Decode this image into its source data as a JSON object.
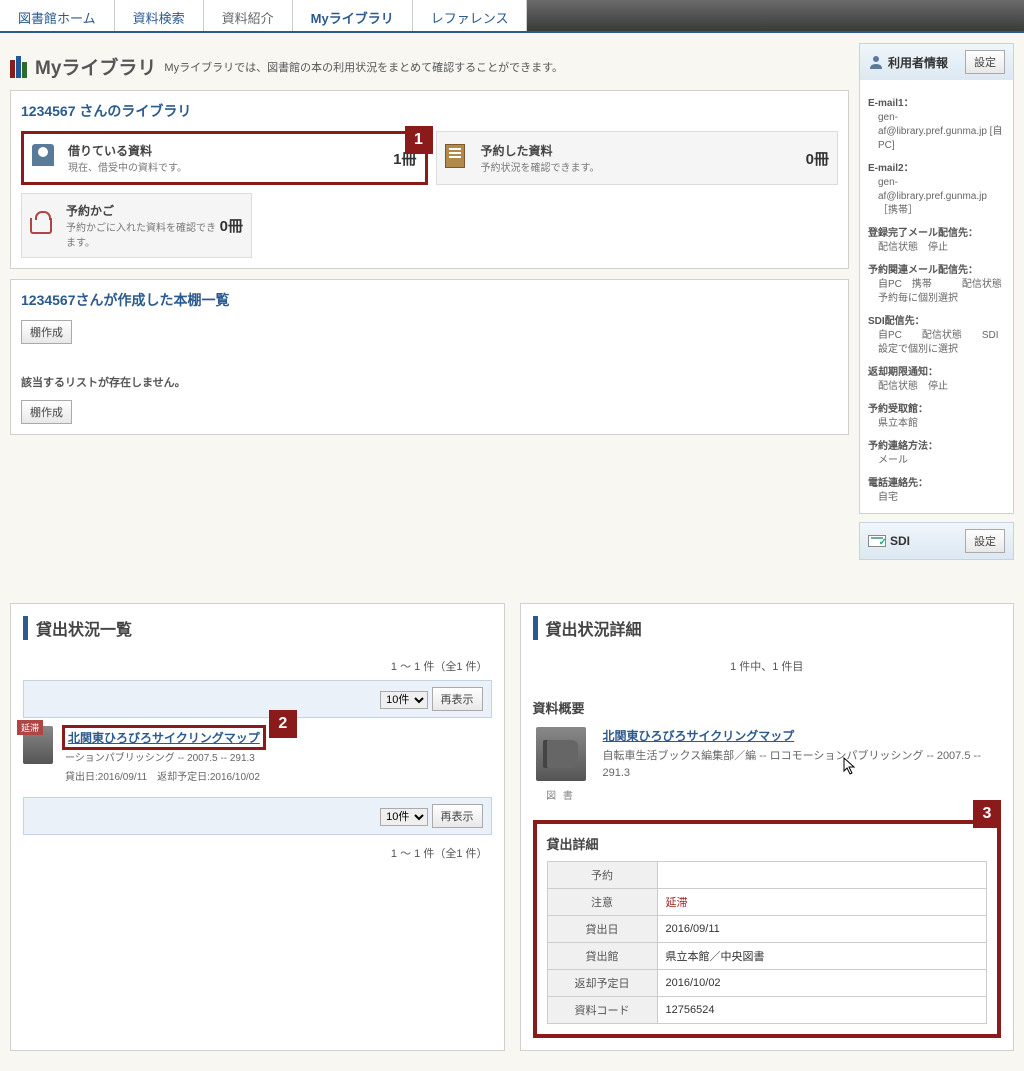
{
  "tabs": [
    "図書館ホーム",
    "資料検索",
    "資料紹介",
    "Myライブラリ",
    "レファレンス"
  ],
  "myLib": {
    "title": "Myライブラリ",
    "desc": "Myライブラリでは、図書館の本の利用状況をまとめて確認することができます。"
  },
  "userLib": {
    "title": "1234567 さんのライブラリ",
    "cards": {
      "borrowed": {
        "title": "借りている資料",
        "sub": "現在、借受中の資料です。",
        "count": "1冊"
      },
      "reserved": {
        "title": "予約した資料",
        "sub": "予約状況を確認できます。",
        "count": "0冊"
      },
      "cart": {
        "title": "予約かご",
        "sub": "予約かごに入れた資料を確認できます。",
        "count": "0冊"
      }
    }
  },
  "shelf": {
    "title": "1234567さんが作成した本棚一覧",
    "createBtn": "棚作成",
    "noList": "該当するリストが存在しません。"
  },
  "userInfo": {
    "header": "利用者情報",
    "settingBtn": "設定",
    "email1Label": "E-mail1：",
    "email1": "gen-af@library.pref.gunma.jp [自PC]",
    "email2Label": "E-mail2：",
    "email2": "gen-af@library.pref.gunma.jp ［携帯］",
    "regMailLabel": "登録完了メール配信先：",
    "regMailVal": "配信状態　停止",
    "resMailLabel": "予約関連メール配信先：",
    "resMailVal1": "自PC　携帯　　　配信状態",
    "resMailVal2": "予約毎に個別選択",
    "sdiMailLabel": "SDI配信先：",
    "sdiMailVal1": "自PC　　配信状態　　SDI設定で個別に選択",
    "returnLabel": "返却期限通知：",
    "returnVal": "配信状態　停止",
    "pickupLabel": "予約受取館：",
    "pickupVal": "県立本館",
    "contactLabel": "予約連絡方法：",
    "contactVal": "メール",
    "phoneLabel": "電話連絡先：",
    "phoneVal": "自宅"
  },
  "sdi": {
    "header": "SDI",
    "settingBtn": "設定"
  },
  "loanList": {
    "title": "貸出状況一覧",
    "pager": "1 ～ 1 件（全1 件）",
    "perPage": "10件",
    "refreshBtn": "再表示",
    "overdueBadge": "延滞",
    "bookTitle": "北関東ひろびろサイクリングマップ",
    "bookMeta1": "ーションパブリッシング -- 2007.5 -- 291.3",
    "bookMeta2": "貸出日:2016/09/11　返却予定日:2016/10/02"
  },
  "loanDetail": {
    "title": "貸出状況詳細",
    "pager": "1 件中、1 件目",
    "overviewLabel": "資料概要",
    "bookTitle": "北関東ひろびろサイクリングマップ",
    "bookMeta": "自転車生活ブックス編集部／編 -- ロコモーションパブリッシング -- 2007.5 -- 291.3",
    "bookType": "図 書",
    "detailLabel": "貸出詳細",
    "rows": {
      "reserve": {
        "th": "予約",
        "td": ""
      },
      "caution": {
        "th": "注意",
        "td": "延滞"
      },
      "loanDate": {
        "th": "貸出日",
        "td": "2016/09/11"
      },
      "loanLib": {
        "th": "貸出館",
        "td": "県立本館／中央図書"
      },
      "dueDate": {
        "th": "返却予定日",
        "td": "2016/10/02"
      },
      "matCode": {
        "th": "資料コード",
        "td": "12756524"
      }
    }
  },
  "callouts": {
    "c1": "1",
    "c2": "2",
    "c3": "3"
  }
}
